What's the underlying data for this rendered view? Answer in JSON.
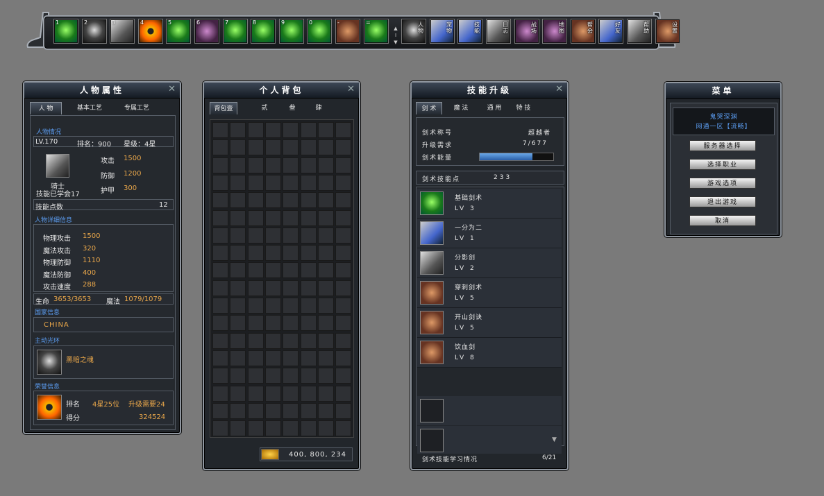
{
  "hotbar": {
    "slots": [
      {
        "num": "1",
        "lbl": "",
        "style": "g-green"
      },
      {
        "num": "2",
        "lbl": "",
        "style": "g-dark"
      },
      {
        "num": "3",
        "lbl": "",
        "style": "g-gray"
      },
      {
        "num": "4",
        "lbl": "",
        "style": "g-gold"
      },
      {
        "num": "5",
        "lbl": "",
        "style": "g-green"
      },
      {
        "num": "6",
        "lbl": "",
        "style": "g-purple"
      },
      {
        "num": "7",
        "lbl": "",
        "style": "g-green"
      },
      {
        "num": "8",
        "lbl": "",
        "style": "g-green"
      },
      {
        "num": "9",
        "lbl": "",
        "style": "g-green"
      },
      {
        "num": "0",
        "lbl": "",
        "style": "g-green"
      },
      {
        "num": "-",
        "lbl": "",
        "style": "g-brown"
      },
      {
        "num": "=",
        "lbl": "",
        "style": "g-green"
      },
      {
        "num": "",
        "lbl": "人物",
        "style": "g-dark"
      },
      {
        "num": "",
        "lbl": "宠物",
        "style": "g-mix"
      },
      {
        "num": "",
        "lbl": "技能",
        "style": "g-mix"
      },
      {
        "num": "",
        "lbl": "日志",
        "style": "g-gray"
      },
      {
        "num": "",
        "lbl": "战场",
        "style": "g-purple"
      },
      {
        "num": "",
        "lbl": "地图",
        "style": "g-purple"
      },
      {
        "num": "",
        "lbl": "帮会",
        "style": "g-brown"
      },
      {
        "num": "",
        "lbl": "好友",
        "style": "g-mix"
      },
      {
        "num": "",
        "lbl": "帮助",
        "style": "g-gray"
      },
      {
        "num": "",
        "lbl": "设置",
        "style": "g-brown"
      }
    ]
  },
  "character": {
    "title": "人物属性",
    "tabs": [
      "人 物",
      "基本工艺",
      "专属工艺"
    ],
    "sec_info": "人物情况",
    "level": "LV.170",
    "rank": "排名：900",
    "star": "星级：4星",
    "job": "骑士",
    "learned": "技能已学会17",
    "atk_l": "攻击",
    "atk": "1500",
    "def_l": "防御",
    "def": "1200",
    "arm_l": "护甲",
    "arm": "300",
    "skillpts_l": "技能点数",
    "skillpts": "12",
    "sec_detail": "人物详细信息",
    "details": [
      {
        "k": "物理攻击",
        "v": "1500"
      },
      {
        "k": "魔法攻击",
        "v": "320"
      },
      {
        "k": "物理防御",
        "v": "1110"
      },
      {
        "k": "魔法防御",
        "v": "400"
      },
      {
        "k": "攻击速度",
        "v": "288"
      }
    ],
    "hp_l": "生命",
    "hp": "3653/3653",
    "mp_l": "魔法",
    "mp": "1079/1079",
    "sec_nation": "国家信息",
    "nation": "CHINA",
    "sec_aura": "主动光环",
    "aura": "黑暗之魂",
    "sec_honor": "荣誉信息",
    "rank_l": "排名",
    "rank_v": "4星25位",
    "upgrade": "升级需要24",
    "score_l": "得分",
    "score": "324524"
  },
  "bag": {
    "title": "个人背包",
    "tabs": [
      "背包壹",
      "贰",
      "叁",
      "肆"
    ],
    "money": "400, 800, 234"
  },
  "skills": {
    "title": "技能升级",
    "tabs": [
      "剑 术",
      "魔 法",
      "通 用",
      "特 技"
    ],
    "title_l": "剑术称号",
    "title_v": "超越者",
    "need_l": "升级需求",
    "need_v": "7/677",
    "energy_l": "剑术能量",
    "energy_fill": 0.72,
    "pts_l": "剑术技能点",
    "pts_v": "233",
    "list": [
      {
        "name": "基础剑术",
        "lv": "LV 3",
        "style": "g-green"
      },
      {
        "name": "一分为二",
        "lv": "LV 1",
        "style": "g-mix"
      },
      {
        "name": "分影剑",
        "lv": "LV 2",
        "style": "g-gray"
      },
      {
        "name": "穿刺剑术",
        "lv": "LV 5",
        "style": "g-brown"
      },
      {
        "name": "开山剑诀",
        "lv": "LV 5",
        "style": "g-brown"
      },
      {
        "name": "饮血剑",
        "lv": "LV 8",
        "style": "g-brown"
      }
    ],
    "footer_l": "剑术技能学习情况",
    "footer_v": "6/21"
  },
  "menu": {
    "title": "菜单",
    "server": "鬼哭深渊",
    "zone": "网通一区【流畅】",
    "buttons": [
      "服务器选择",
      "选择职业",
      "游戏选项",
      "退出游戏",
      "取消"
    ]
  }
}
